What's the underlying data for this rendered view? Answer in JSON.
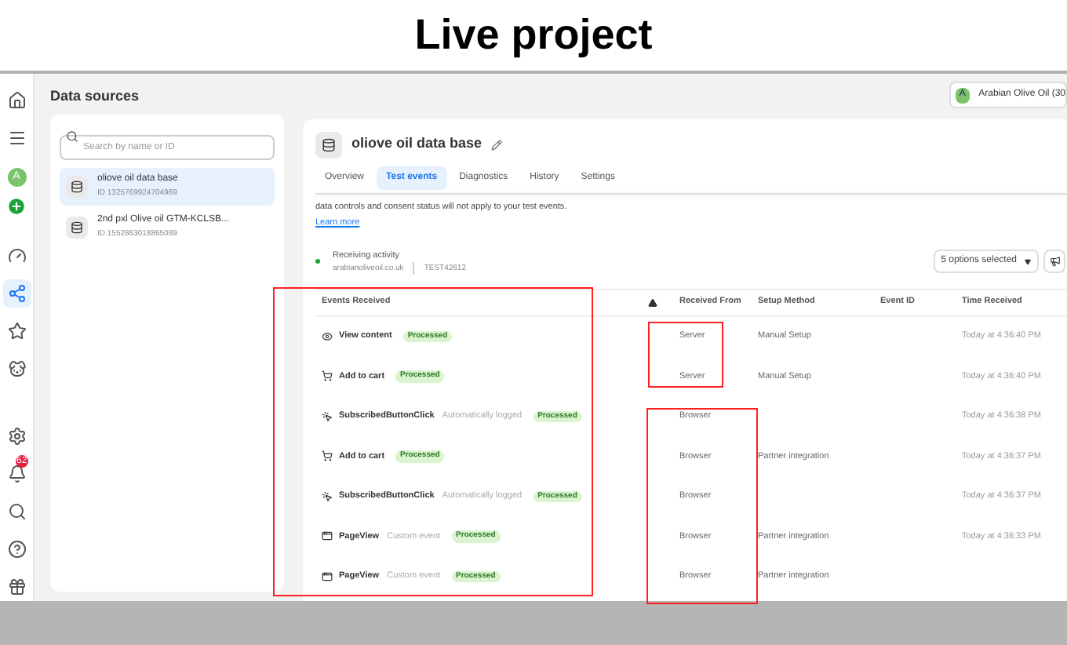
{
  "banner": {
    "title": "Live project"
  },
  "rail": {
    "avatar": "A",
    "notification_badge": "62"
  },
  "data_sources": {
    "title": "Data sources",
    "search": {
      "placeholder": "Search by name or ID"
    },
    "items": [
      {
        "name": "oliove oil data base",
        "id": "ID 1325769924704969",
        "selected": true
      },
      {
        "name": "2nd pxl Olive oil GTM-KCLSB...",
        "id": "ID 1552863018865089",
        "selected": false
      }
    ]
  },
  "account": {
    "avatar": "A",
    "name": "Arabian Olive Oil (30"
  },
  "dataset": {
    "title": "oliove oil data base",
    "tabs": [
      {
        "label": "Overview",
        "selected": false
      },
      {
        "label": "Test events",
        "selected": true
      },
      {
        "label": "Diagnostics",
        "selected": false
      },
      {
        "label": "History",
        "selected": false
      },
      {
        "label": "Settings",
        "selected": false
      }
    ],
    "notice": "data controls and consent status will not apply to your test events.",
    "learn_more": "Learn more",
    "status": {
      "label": "Receiving activity",
      "domain": "arabianoliveoil.co.uk",
      "code": "TEST42612",
      "active": true
    },
    "filter": "5 options selected",
    "table": {
      "columns": [
        "Events Received",
        "Received From",
        "Setup Method",
        "Event ID",
        "Time Received"
      ],
      "rows": [
        {
          "kind": "view",
          "event": "View content",
          "tag": "",
          "status": "Processed",
          "from": "Server",
          "setup": "Manual Setup",
          "time": "Today at 4:36:40 PM"
        },
        {
          "kind": "cart",
          "event": "Add to cart",
          "tag": "",
          "status": "Processed",
          "from": "Server",
          "setup": "Manual Setup",
          "time": "Today at 4:36:40 PM"
        },
        {
          "kind": "click",
          "event": "SubscribedButtonClick",
          "tag": "Automatically logged",
          "status": "Processed",
          "from": "Browser",
          "setup": "",
          "time": "Today at 4:36:38 PM"
        },
        {
          "kind": "cart",
          "event": "Add to cart",
          "tag": "",
          "status": "Processed",
          "from": "Browser",
          "setup": "Partner integration",
          "time": "Today at 4:36:37 PM"
        },
        {
          "kind": "click",
          "event": "SubscribedButtonClick",
          "tag": "Automatically logged",
          "status": "Processed",
          "from": "Browser",
          "setup": "",
          "time": "Today at 4:36:37 PM"
        },
        {
          "kind": "page",
          "event": "PageView",
          "tag": "Custom event",
          "status": "Processed",
          "from": "Browser",
          "setup": "Partner integration",
          "time": "Today at 4:36:33 PM"
        },
        {
          "kind": "page",
          "event": "PageView",
          "tag": "Custom event",
          "status": "Processed",
          "from": "Browser",
          "setup": "Partner integration",
          "time": ""
        }
      ]
    }
  }
}
